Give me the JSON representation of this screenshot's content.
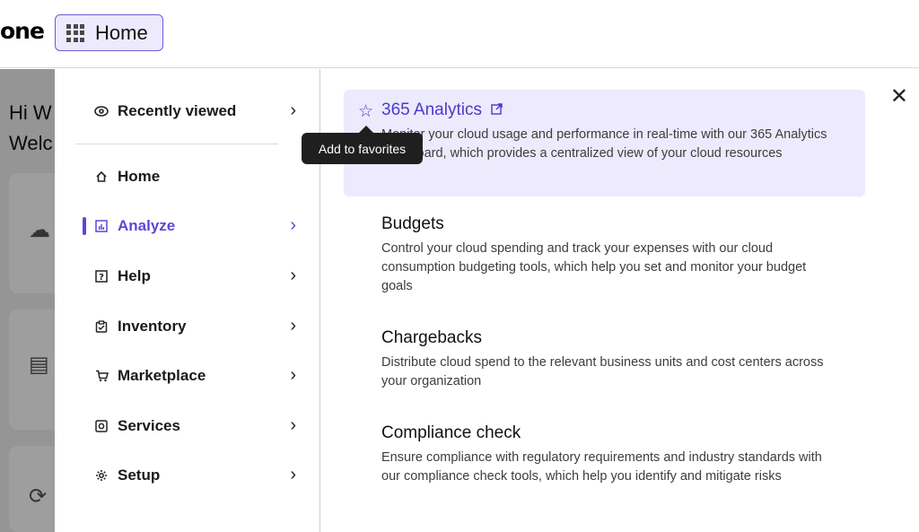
{
  "topbar": {
    "logo": "one",
    "home_label": "Home"
  },
  "background": {
    "greeting_line1": "Hi W",
    "greeting_line2": "Welc"
  },
  "nav": {
    "recently_viewed": "Recently viewed",
    "items": [
      {
        "label": "Home",
        "icon": "home-icon",
        "chevron": false
      },
      {
        "label": "Analyze",
        "icon": "chart-icon",
        "chevron": true,
        "active": true
      },
      {
        "label": "Help",
        "icon": "help-icon",
        "chevron": true
      },
      {
        "label": "Inventory",
        "icon": "inventory-icon",
        "chevron": true
      },
      {
        "label": "Marketplace",
        "icon": "cart-icon",
        "chevron": true
      },
      {
        "label": "Services",
        "icon": "services-icon",
        "chevron": true
      },
      {
        "label": "Setup",
        "icon": "gear-icon",
        "chevron": true
      }
    ]
  },
  "tooltip": "Add to favorites",
  "content": {
    "items": [
      {
        "title": "365 Analytics",
        "desc": "Monitor your cloud usage and performance in real-time with our 365 Analytics dashboard, which provides a centralized view of your cloud resources"
      },
      {
        "title": "Budgets",
        "desc": "Control your cloud spending and track your expenses with our cloud consumption budgeting tools, which help you set and monitor your budget goals"
      },
      {
        "title": "Chargebacks",
        "desc": "Distribute cloud spend to the relevant business units and cost centers across your organization"
      },
      {
        "title": "Compliance check",
        "desc": "Ensure compliance with regulatory requirements and industry standards with our compliance check tools, which help you identify and mitigate risks"
      }
    ]
  },
  "colors": {
    "accent": "#5b47d6",
    "highlight_bg": "#eceafc"
  }
}
